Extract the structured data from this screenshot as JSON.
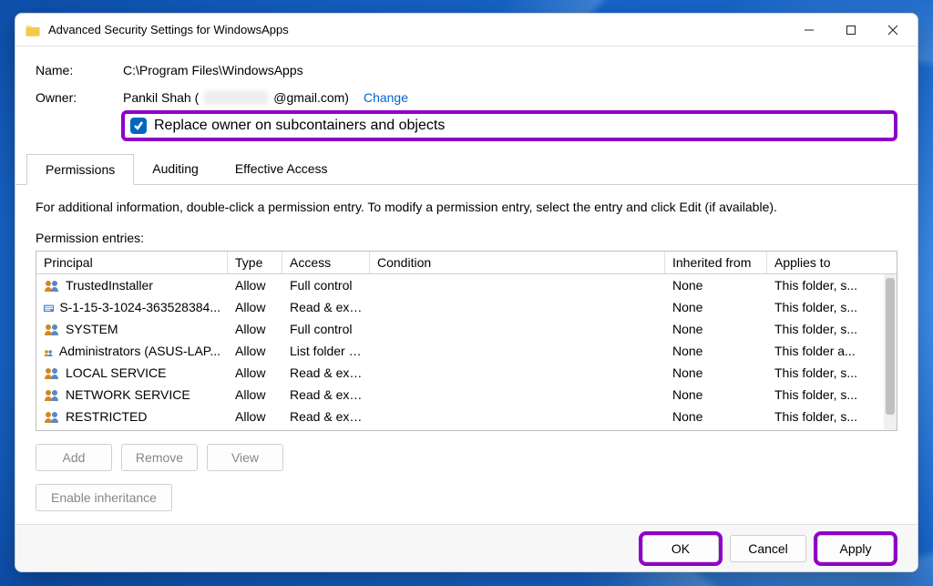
{
  "window": {
    "title": "Advanced Security Settings for WindowsApps"
  },
  "header": {
    "name_label": "Name:",
    "name_value": "C:\\Program Files\\WindowsApps",
    "owner_label": "Owner:",
    "owner_prefix": "Pankil Shah (",
    "owner_suffix": "@gmail.com)",
    "change_link": "Change",
    "replace_owner_checkbox": "Replace owner on subcontainers and objects"
  },
  "tabs": [
    {
      "label": "Permissions",
      "active": true
    },
    {
      "label": "Auditing",
      "active": false
    },
    {
      "label": "Effective Access",
      "active": false
    }
  ],
  "info_text": "For additional information, double-click a permission entry. To modify a permission entry, select the entry and click Edit (if available).",
  "entries_label": "Permission entries:",
  "columns": {
    "principal": "Principal",
    "type": "Type",
    "access": "Access",
    "condition": "Condition",
    "inherited": "Inherited from",
    "applies": "Applies to"
  },
  "entries": [
    {
      "icon": "group",
      "principal": "TrustedInstaller",
      "type": "Allow",
      "access": "Full control",
      "condition": "",
      "inherited": "None",
      "applies": "This folder, s..."
    },
    {
      "icon": "sid",
      "principal": "S-1-15-3-1024-363528384...",
      "type": "Allow",
      "access": "Read & exe...",
      "condition": "",
      "inherited": "None",
      "applies": "This folder, s..."
    },
    {
      "icon": "group",
      "principal": "SYSTEM",
      "type": "Allow",
      "access": "Full control",
      "condition": "",
      "inherited": "None",
      "applies": "This folder, s..."
    },
    {
      "icon": "group",
      "principal": "Administrators (ASUS-LAP...",
      "type": "Allow",
      "access": "List folder c...",
      "condition": "",
      "inherited": "None",
      "applies": "This folder a..."
    },
    {
      "icon": "group",
      "principal": "LOCAL SERVICE",
      "type": "Allow",
      "access": "Read & exe...",
      "condition": "",
      "inherited": "None",
      "applies": "This folder, s..."
    },
    {
      "icon": "group",
      "principal": "NETWORK SERVICE",
      "type": "Allow",
      "access": "Read & exe...",
      "condition": "",
      "inherited": "None",
      "applies": "This folder, s..."
    },
    {
      "icon": "group",
      "principal": "RESTRICTED",
      "type": "Allow",
      "access": "Read & exe...",
      "condition": "",
      "inherited": "None",
      "applies": "This folder, s..."
    }
  ],
  "buttons": {
    "add": "Add",
    "remove": "Remove",
    "view": "View",
    "enable_inheritance": "Enable inheritance",
    "ok": "OK",
    "cancel": "Cancel",
    "apply": "Apply"
  }
}
